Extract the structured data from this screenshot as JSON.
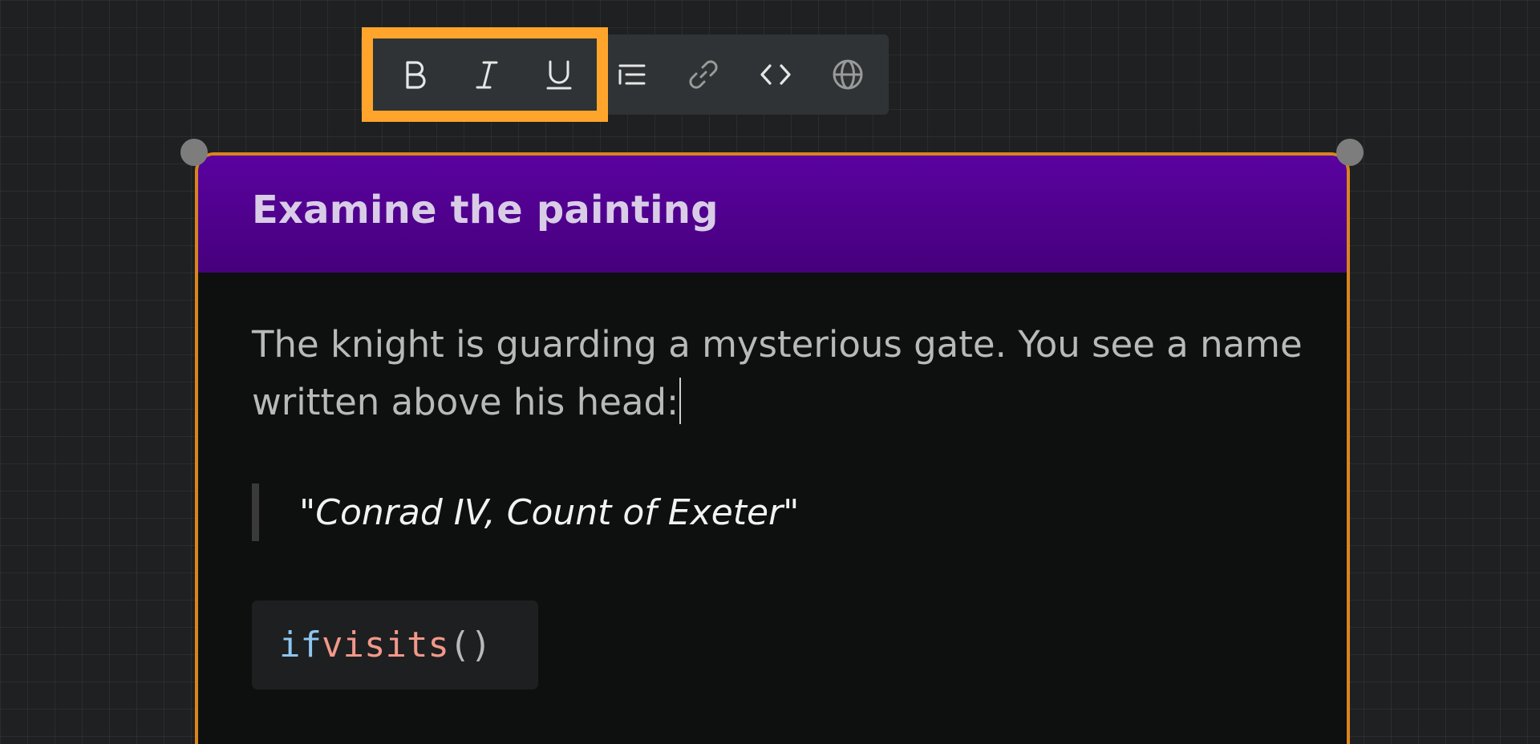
{
  "toolbar": {
    "buttons": [
      {
        "name": "bold",
        "icon": "bold-icon",
        "label": "B"
      },
      {
        "name": "italic",
        "icon": "italic-icon",
        "label": "I"
      },
      {
        "name": "underline",
        "icon": "underline-icon",
        "label": "U"
      },
      {
        "name": "list",
        "icon": "list-icon"
      },
      {
        "name": "link",
        "icon": "link-icon"
      },
      {
        "name": "code",
        "icon": "code-icon"
      },
      {
        "name": "globe",
        "icon": "globe-icon"
      }
    ],
    "highlight_color": "#ffa52c"
  },
  "node": {
    "title": "Examine the painting",
    "body": "The knight is guarding a mysterious gate. You see a name written above his head:",
    "quote": "\"Conrad IV, Count of Exeter\"",
    "code": {
      "keyword": "if",
      "function": "visits",
      "punct": "()"
    },
    "colors": {
      "header": "#5a02a0",
      "border": "#d9851e",
      "background": "#0e0f0f"
    }
  }
}
